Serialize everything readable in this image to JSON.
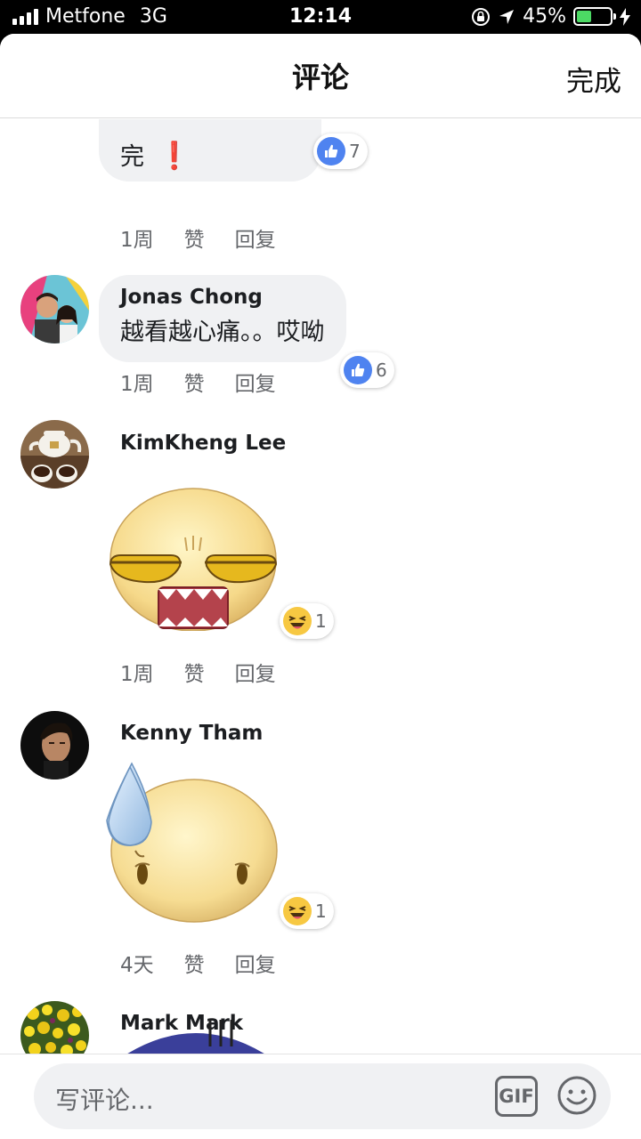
{
  "status": {
    "carrier": "Metfone",
    "network": "3G",
    "time": "12:14",
    "battery": "45%",
    "battery_level": 0.45
  },
  "header": {
    "title": "评论",
    "done": "完成"
  },
  "comments": [
    {
      "text": "完",
      "like_count": "7",
      "time": "1周",
      "like": "赞",
      "reply": "回复"
    },
    {
      "name": "Jonas Chong",
      "text": "越看越心痛。。哎呦",
      "like_count": "6",
      "time": "1周",
      "like": "赞",
      "reply": "回复"
    },
    {
      "name": "KimKheng Lee",
      "reaction_count": "1",
      "time": "1周",
      "like": "赞",
      "reply": "回复"
    },
    {
      "name": "Kenny Tham",
      "reaction_count": "1",
      "time": "4天",
      "like": "赞",
      "reply": "回复"
    },
    {
      "name": "Mark Mark"
    }
  ],
  "composer": {
    "placeholder": "写评论...",
    "gif": "GIF"
  },
  "colors": {
    "like_blue": "#4f83f0",
    "bubble_gray": "#f0f1f3",
    "meta_gray": "#65676b"
  }
}
